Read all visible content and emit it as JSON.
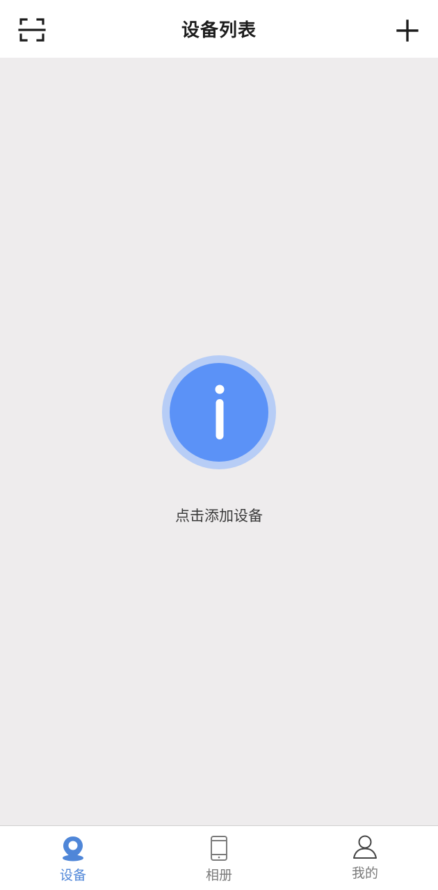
{
  "header": {
    "title": "设备列表",
    "scan_icon": "scan-frame-icon",
    "add_icon": "plus-icon"
  },
  "empty_state": {
    "icon": "info-icon",
    "message": "点击添加设备"
  },
  "tabbar": {
    "tabs": [
      {
        "label": "设备",
        "icon": "location-pin-icon",
        "active": true
      },
      {
        "label": "相册",
        "icon": "tablet-icon",
        "active": false
      },
      {
        "label": "我的",
        "icon": "user-icon",
        "active": false
      }
    ]
  },
  "colors": {
    "accent": "#5b92f7",
    "accent_ring": "#b7cdf6",
    "tab_active": "#4f86d8",
    "tab_inactive": "#7a7a7a",
    "background": "#eeeced",
    "header_bg": "#ffffff"
  }
}
